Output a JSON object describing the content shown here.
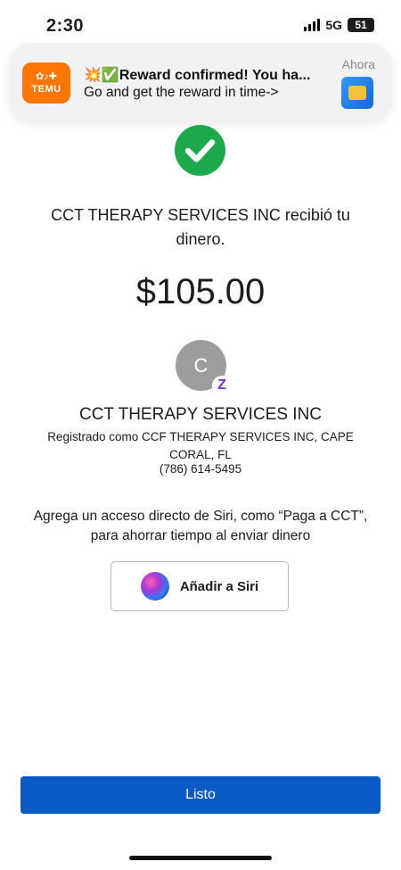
{
  "status_bar": {
    "time": "2:30",
    "network": "5G",
    "battery": "51"
  },
  "notification": {
    "app_icon": "temu-app-icon",
    "app_name": "TEMU",
    "title_emoji": "💥✅",
    "title": "Reward confirmed! You ha...",
    "body": "Go and get the reward in time->",
    "time": "Ahora"
  },
  "receipt": {
    "success_icon": "check-circle-icon",
    "message": "CCT THERAPY SERVICES INC recibió tu dinero.",
    "amount": "$105.00"
  },
  "recipient": {
    "avatar_initial": "C",
    "name": "CCT THERAPY SERVICES INC",
    "registered_as": "Registrado como CCF THERAPY SERVICES INC, CAPE CORAL, FL",
    "phone": "(786) 614-5495"
  },
  "siri": {
    "message": "Agrega un acceso directo de Siri, como “Paga a CCT”, para ahorrar tiempo al enviar dinero",
    "button_label": "Añadir a Siri"
  },
  "footer": {
    "done_label": "Listo"
  },
  "colors": {
    "success_green": "#1da94b",
    "primary_blue": "#0a59c4",
    "zelle_purple": "#7a2bd6",
    "temu_orange": "#fb7701"
  }
}
